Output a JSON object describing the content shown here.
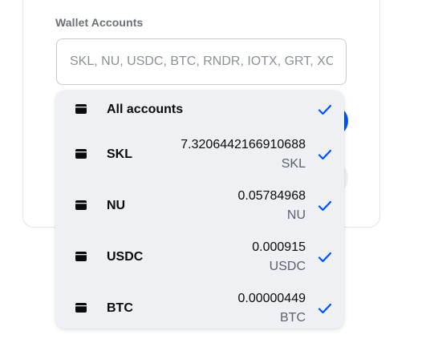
{
  "form": {
    "label": "Wallet Accounts",
    "input_placeholder": "SKL, NU, USDC, BTC, RNDR, IOTX, GRT, XCN,",
    "input_value": ""
  },
  "dropdown": {
    "all": {
      "label": "All accounts",
      "selected": true
    },
    "accounts": [
      {
        "name": "SKL",
        "amount": "7.3206442166910688",
        "unit": "SKL",
        "selected": true
      },
      {
        "name": "NU",
        "amount": "0.05784968",
        "unit": "NU",
        "selected": true
      },
      {
        "name": "USDC",
        "amount": "0.000915",
        "unit": "USDC",
        "selected": true
      },
      {
        "name": "BTC",
        "amount": "0.00000449",
        "unit": "BTC",
        "selected": true
      }
    ]
  },
  "icons": {
    "account": "wallet-icon",
    "selected": "checkmark-icon"
  },
  "colors": {
    "accent": "#0052ff",
    "dropdown_bg": "#eef0f3",
    "label": "#6b7079",
    "muted_text": "#5b616e"
  }
}
